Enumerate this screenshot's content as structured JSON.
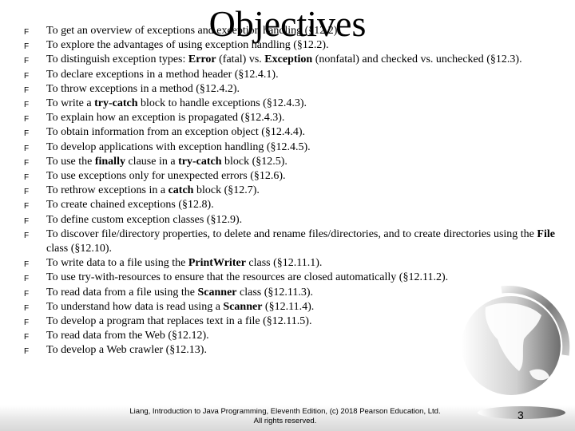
{
  "slide": {
    "title": "Objectives",
    "bullet_glyph": "F",
    "items": [
      {
        "parts": [
          {
            "t": "To get an overview of exceptions and exception handling (§12.2).",
            "b": false
          }
        ]
      },
      {
        "parts": [
          {
            "t": "To explore the advantages of using exception handling (§12.2).",
            "b": false
          }
        ]
      },
      {
        "parts": [
          {
            "t": "To distinguish exception types: ",
            "b": false
          },
          {
            "t": "Error",
            "b": true
          },
          {
            "t": " (fatal) vs. ",
            "b": false
          },
          {
            "t": "Exception",
            "b": true
          },
          {
            "t": " (nonfatal) and checked vs. unchecked (§12.3).",
            "b": false
          }
        ]
      },
      {
        "parts": [
          {
            "t": "To declare exceptions in a method header (§12.4.1).",
            "b": false
          }
        ]
      },
      {
        "parts": [
          {
            "t": "To throw exceptions in a method (§12.4.2).",
            "b": false
          }
        ]
      },
      {
        "parts": [
          {
            "t": "To write a ",
            "b": false
          },
          {
            "t": "try-catch",
            "b": true
          },
          {
            "t": " block to handle exceptions (§12.4.3).",
            "b": false
          }
        ]
      },
      {
        "parts": [
          {
            "t": "To explain how an exception is propagated (§12.4.3).",
            "b": false
          }
        ]
      },
      {
        "parts": [
          {
            "t": "To obtain information from an exception object (§12.4.4).",
            "b": false
          }
        ]
      },
      {
        "parts": [
          {
            "t": "To develop applications with exception handling (§12.4.5).",
            "b": false
          }
        ]
      },
      {
        "parts": [
          {
            "t": "To use the ",
            "b": false
          },
          {
            "t": "finally",
            "b": true
          },
          {
            "t": " clause in a ",
            "b": false
          },
          {
            "t": "try-catch",
            "b": true
          },
          {
            "t": " block (§12.5).",
            "b": false
          }
        ]
      },
      {
        "parts": [
          {
            "t": "To use exceptions only for unexpected errors (§12.6).",
            "b": false
          }
        ]
      },
      {
        "parts": [
          {
            "t": "To rethrow exceptions in a ",
            "b": false
          },
          {
            "t": "catch",
            "b": true
          },
          {
            "t": " block (§12.7).",
            "b": false
          }
        ]
      },
      {
        "parts": [
          {
            "t": "To create chained exceptions (§12.8).",
            "b": false
          }
        ]
      },
      {
        "parts": [
          {
            "t": "To define custom exception classes (§12.9).",
            "b": false
          }
        ]
      },
      {
        "parts": [
          {
            "t": "To discover file/directory properties, to delete and rename files/directories, and to create directories using the ",
            "b": false
          },
          {
            "t": "File",
            "b": true
          },
          {
            "t": " class (§12.10).",
            "b": false
          }
        ]
      },
      {
        "parts": [
          {
            "t": "To write data to a file using the ",
            "b": false
          },
          {
            "t": "PrintWriter",
            "b": true
          },
          {
            "t": " class (§12.11.1).",
            "b": false
          }
        ]
      },
      {
        "parts": [
          {
            "t": "To use try-with-resources to ensure that the resources are closed automatically (§12.11.2).",
            "b": false
          }
        ]
      },
      {
        "parts": [
          {
            "t": "To read data from a file using the ",
            "b": false
          },
          {
            "t": "Scanner",
            "b": true
          },
          {
            "t": " class (§12.11.3).",
            "b": false
          }
        ]
      },
      {
        "parts": [
          {
            "t": "To understand how data is read using a ",
            "b": false
          },
          {
            "t": "Scanner",
            "b": true
          },
          {
            "t": " (§12.11.4).",
            "b": false
          }
        ]
      },
      {
        "parts": [
          {
            "t": "To develop a program that replaces text in a file (§12.11.5).",
            "b": false
          }
        ]
      },
      {
        "parts": [
          {
            "t": "To read data from the Web (§12.12).",
            "b": false
          }
        ]
      },
      {
        "parts": [
          {
            "t": "To develop a Web crawler (§12.13).",
            "b": false
          }
        ]
      }
    ],
    "footer_line1": "Liang, Introduction to Java Programming, Eleventh Edition, (c) 2018 Pearson Education, Ltd.",
    "footer_line2": "All rights reserved.",
    "page_number": "3"
  },
  "colors": {
    "text": "#000000",
    "background": "#ffffff",
    "globe_dark": "#6e6e6e",
    "globe_light": "#f2f2f2"
  }
}
